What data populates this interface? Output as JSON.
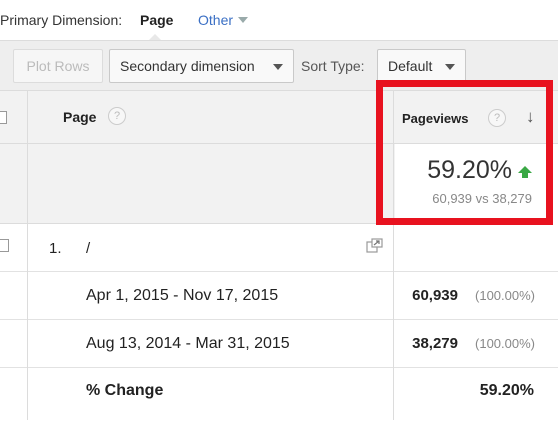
{
  "dimensions": {
    "label": "Primary Dimension:",
    "active": "Page",
    "other": "Other"
  },
  "toolbar": {
    "plot_rows": "Plot Rows",
    "secondary_dimension": "Secondary dimension",
    "sort_type_label": "Sort Type:",
    "sort_type_value": "Default"
  },
  "table": {
    "headers": {
      "page": "Page",
      "pageviews": "Pageviews",
      "help": "?",
      "sort_indicator": "↓"
    },
    "summary": {
      "change_percent": "59.20%",
      "comparison": "60,939 vs 38,279"
    },
    "rows": [
      {
        "number": "1.",
        "page": "/"
      }
    ],
    "ranges": [
      {
        "label": "Apr 1, 2015 - Nov 17, 2015",
        "pageviews": "60,939",
        "percent": "(100.00%)"
      },
      {
        "label": "Aug 13, 2014 - Mar 31, 2015",
        "pageviews": "38,279",
        "percent": "(100.00%)"
      }
    ],
    "change": {
      "label": "% Change",
      "value": "59.20%"
    }
  },
  "icons": {
    "other_caret": "chevron-down-icon",
    "dropdown_caret": "chevron-down-icon",
    "help": "help-circle-icon",
    "sort": "arrow-down-icon",
    "trend": "arrow-up-icon",
    "external": "open-external-icon"
  },
  "colors": {
    "highlight": "#e8121f",
    "trend_up": "#3aa845",
    "link": "#3a6fc4"
  }
}
